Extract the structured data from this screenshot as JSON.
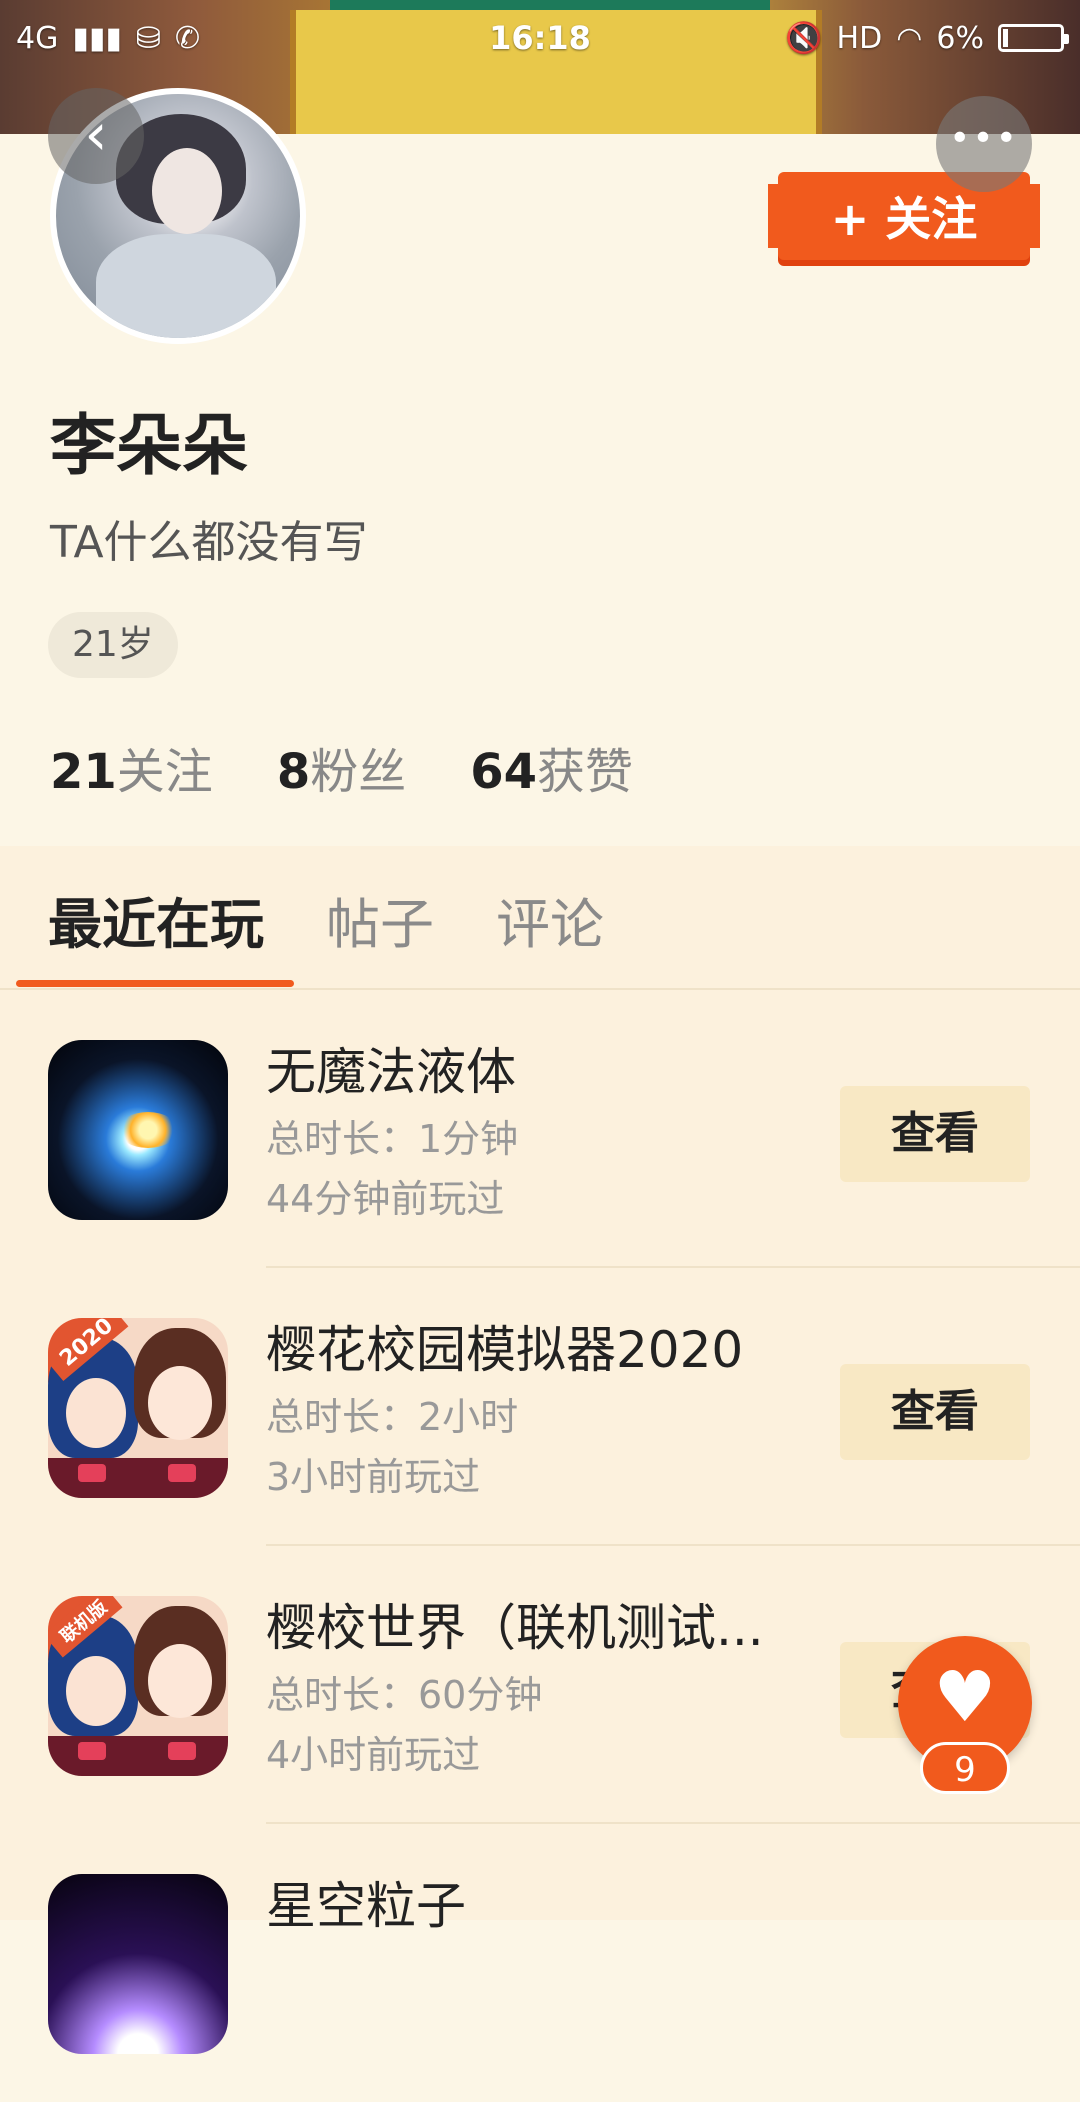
{
  "status_bar": {
    "network": "4G",
    "time": "16:18",
    "hd": "HD",
    "battery": "6%"
  },
  "icons": {
    "back": "chevron-left-icon",
    "more": "more-dots-icon",
    "like": "heart-icon"
  },
  "profile": {
    "follow_label": "+ 关注",
    "name": "李朵朵",
    "bio": "TA什么都没有写",
    "age_tag": "21岁",
    "stats": [
      {
        "num": "21",
        "label": "关注"
      },
      {
        "num": "8",
        "label": "粉丝"
      },
      {
        "num": "64",
        "label": "获赞"
      }
    ]
  },
  "tabs": [
    {
      "label": "最近在玩",
      "active": true
    },
    {
      "label": "帖子",
      "active": false
    },
    {
      "label": "评论",
      "active": false
    }
  ],
  "games": [
    {
      "title": "无魔法液体",
      "duration": "总时长：1分钟",
      "last_played": "44分钟前玩过",
      "action": "查看"
    },
    {
      "title": "樱花校园模拟器2020",
      "duration": "总时长：2小时",
      "last_played": "3小时前玩过",
      "action": "查看",
      "badge": "2020"
    },
    {
      "title": "樱校世界（联机测试...",
      "duration": "总时长：60分钟",
      "last_played": "4小时前玩过",
      "action": "查看",
      "badge": "联机版"
    },
    {
      "title": "星空粒子",
      "duration": "",
      "last_played": "",
      "action": ""
    }
  ],
  "like_fab": {
    "count": "9"
  },
  "colors": {
    "accent": "#f15a1d",
    "background": "#fcf6e6",
    "list_background": "#fcf1dd"
  }
}
